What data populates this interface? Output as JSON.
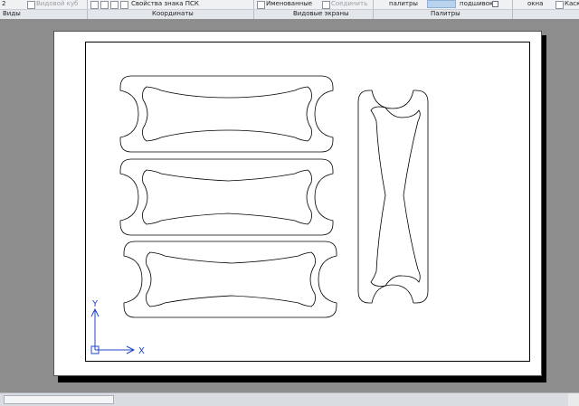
{
  "ribbon": {
    "prev_label": "2",
    "base_view_label": "Видовой куб",
    "ucs_icon_props": "Свойства знака ПСК",
    "named_label": "Именованные",
    "join_label": "Соединить",
    "palettes_label": "палитры",
    "underlay_label": "подшивок",
    "windows_label": "окна",
    "cascade_label": "Каск",
    "panel_views": "Виды",
    "panel_coords": "Координаты",
    "panel_viewports": "Видовые экраны",
    "panel_palettes": "Палитры"
  },
  "ucs": {
    "x_label": "X",
    "y_label": "Y"
  },
  "colors": {
    "background": "#8d8d8d",
    "paper": "#ffffff",
    "linework": "#000000"
  }
}
